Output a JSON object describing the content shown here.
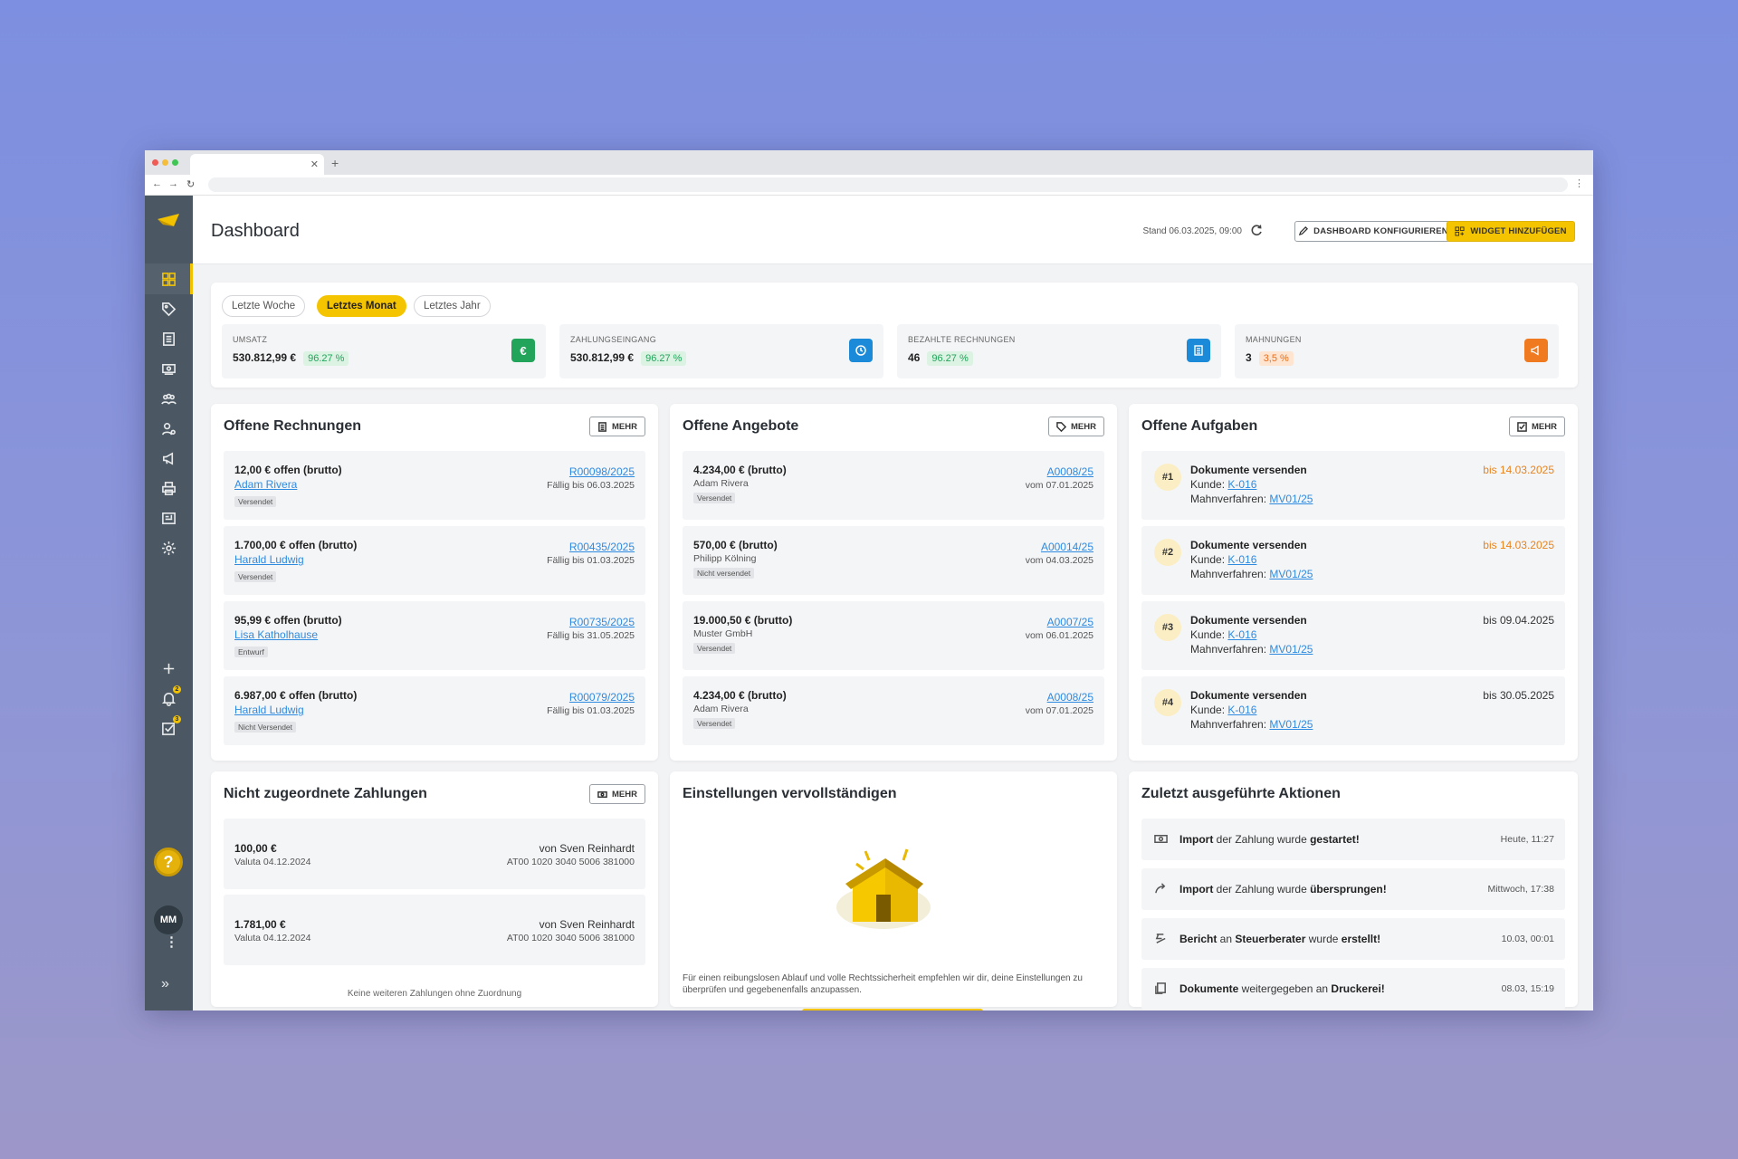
{
  "dashboard": {
    "title": "Dashboard",
    "stand": "Stand 06.03.2025, 09:00",
    "configure_label": "DASHBOARD KONFIGURIEREN",
    "add_widget_label": "WIDGET HINZUFÜGEN"
  },
  "periods": [
    "Letzte Woche",
    "Letztes Monat",
    "Letztes Jahr"
  ],
  "selected_period": "Letztes Monat",
  "kpis": [
    {
      "label": "UMSATZ",
      "value": "530.812,99 €",
      "change": "96.27 %",
      "color": "#22a55b",
      "icon": "euro-icon"
    },
    {
      "label": "ZAHLUNGSEINGANG",
      "value": "530.812,99 €",
      "change": "96.27 %",
      "color": "#1b8ad8",
      "icon": "clock-icon"
    },
    {
      "label": "BEZAHLTE RECHNUNGEN",
      "value": "46",
      "change": "96.27 %",
      "color": "#1b8ad8",
      "icon": "invoice-icon"
    },
    {
      "label": "MAHNUNGEN",
      "value": "3",
      "change": "3,5 %",
      "color": "#f07a1f",
      "icon": "megaphone-icon"
    }
  ],
  "invoices": {
    "title": "Offene Rechnungen",
    "more": "MEHR",
    "items": [
      {
        "amount": "12,00 € offen (brutto)",
        "customer": "Adam Rivera",
        "status": "Versendet",
        "number": "R00098/2025",
        "due": "Fällig bis 06.03.2025"
      },
      {
        "amount": "1.700,00 € offen (brutto)",
        "customer": "Harald Ludwig",
        "status": "Versendet",
        "number": "R00435/2025",
        "due": "Fällig bis 01.03.2025"
      },
      {
        "amount": "95,99 € offen (brutto)",
        "customer": "Lisa Katholhause",
        "status": "Entwurf",
        "number": "R00735/2025",
        "due": "Fällig bis 31.05.2025"
      },
      {
        "amount": "6.987,00 € offen (brutto)",
        "customer": "Harald Ludwig",
        "status": "Nicht Versendet",
        "number": "R00079/2025",
        "due": "Fällig bis 01.03.2025"
      }
    ]
  },
  "offers": {
    "title": "Offene Angebote",
    "more": "MEHR",
    "items": [
      {
        "amount": "4.234,00 € (brutto)",
        "customer": "Adam Rivera",
        "status": "Versendet",
        "number": "A0008/25",
        "date": "vom 07.01.2025"
      },
      {
        "amount": "570,00 € (brutto)",
        "customer": "Philipp Kölning",
        "status": "Nicht versendet",
        "number": "A00014/25",
        "date": "vom 04.03.2025"
      },
      {
        "amount": "19.000,50 € (brutto)",
        "customer": "Muster GmbH",
        "status": "Versendet",
        "number": "A0007/25",
        "date": "vom 06.01.2025"
      },
      {
        "amount": "4.234,00 € (brutto)",
        "customer": "Adam Rivera",
        "status": "Versendet",
        "number": "A0008/25",
        "date": "vom 07.01.2025"
      }
    ]
  },
  "tasks": {
    "title": "Offene Aufgaben",
    "more": "MEHR",
    "items": [
      {
        "num": "#1",
        "title": "Dokumente versenden",
        "kunde_label": "Kunde:",
        "kunde": "K-016",
        "verfahren_label": "Mahnverfahren:",
        "verfahren": "MV01/25",
        "due": "bis 14.03.2025"
      },
      {
        "num": "#2",
        "title": "Dokumente versenden",
        "kunde_label": "Kunde:",
        "kunde": "K-016",
        "verfahren_label": "Mahnverfahren:",
        "verfahren": "MV01/25",
        "due": "bis 14.03.2025"
      },
      {
        "num": "#3",
        "title": "Dokumente versenden",
        "kunde_label": "Kunde:",
        "kunde": "K-016",
        "verfahren_label": "Mahnverfahren:",
        "verfahren": "MV01/25",
        "due": "bis 09.04.2025"
      },
      {
        "num": "#4",
        "title": "Dokumente versenden",
        "kunde_label": "Kunde:",
        "kunde": "K-016",
        "verfahren_label": "Mahnverfahren:",
        "verfahren": "MV01/25",
        "due": "bis 30.05.2025"
      }
    ]
  },
  "payments": {
    "title": "Nicht zugeordnete Zahlungen",
    "more": "MEHR",
    "items": [
      {
        "amount": "100,00 €",
        "valuta": "Valuta 04.12.2024",
        "from": "von Sven Reinhardt",
        "iban": "AT00 1020 3040 5006 381000"
      },
      {
        "amount": "1.781,00 €",
        "valuta": "Valuta 04.12.2024",
        "from": "von Sven Reinhardt",
        "iban": "AT00 1020 3040 5006 381000"
      }
    ],
    "note": "Keine weiteren Zahlungen ohne Zuordnung"
  },
  "settings": {
    "title": "Einstellungen vervollständigen",
    "text": "Für einen reibungslosen Ablauf und volle Rechtssicherheit empfehlen wir dir, deine Einstellungen zu überprüfen und gegebenenfalls anzupassen."
  },
  "actions": {
    "title": "Zuletzt ausgeführte Aktionen",
    "items": [
      {
        "icon": "payment-icon",
        "pre": "Import",
        "mid": " der Zahlung wurde ",
        "post": "gestartet!",
        "time": "Heute, 11:27"
      },
      {
        "icon": "skip-icon",
        "pre": "Import",
        "mid": " der Zahlung wurde ",
        "post": "übersprungen!",
        "time": "Mittwoch, 17:38"
      },
      {
        "icon": "report-icon",
        "pre": "Bericht",
        "mid": " an ",
        "post": "Steuerberater",
        "mid2": " wurde ",
        "post2": "erstellt!",
        "time": "10.03, 00:01"
      },
      {
        "icon": "documents-icon",
        "pre": "Dokumente",
        "mid": " weitergegeben an ",
        "post": "Druckerei!",
        "time": "08.03, 15:19"
      }
    ]
  },
  "sidebar": {
    "avatar": "MM",
    "help": "?",
    "notifications_badge": "2",
    "tasks_badge": "3"
  }
}
